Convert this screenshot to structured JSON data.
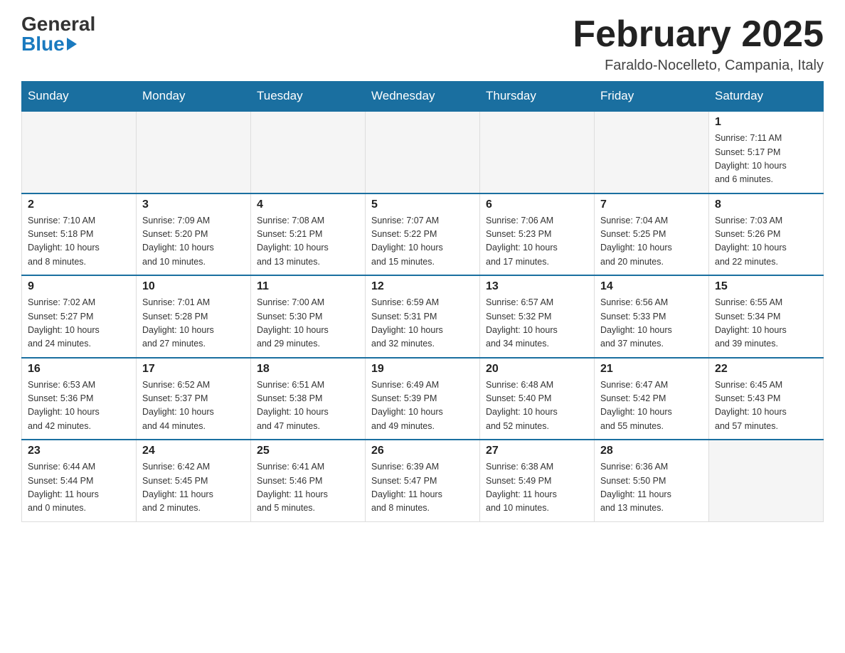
{
  "logo": {
    "line1": "General",
    "line2": "Blue"
  },
  "header": {
    "title": "February 2025",
    "subtitle": "Faraldo-Nocelleto, Campania, Italy"
  },
  "weekdays": [
    "Sunday",
    "Monday",
    "Tuesday",
    "Wednesday",
    "Thursday",
    "Friday",
    "Saturday"
  ],
  "weeks": [
    [
      {
        "day": "",
        "info": ""
      },
      {
        "day": "",
        "info": ""
      },
      {
        "day": "",
        "info": ""
      },
      {
        "day": "",
        "info": ""
      },
      {
        "day": "",
        "info": ""
      },
      {
        "day": "",
        "info": ""
      },
      {
        "day": "1",
        "info": "Sunrise: 7:11 AM\nSunset: 5:17 PM\nDaylight: 10 hours\nand 6 minutes."
      }
    ],
    [
      {
        "day": "2",
        "info": "Sunrise: 7:10 AM\nSunset: 5:18 PM\nDaylight: 10 hours\nand 8 minutes."
      },
      {
        "day": "3",
        "info": "Sunrise: 7:09 AM\nSunset: 5:20 PM\nDaylight: 10 hours\nand 10 minutes."
      },
      {
        "day": "4",
        "info": "Sunrise: 7:08 AM\nSunset: 5:21 PM\nDaylight: 10 hours\nand 13 minutes."
      },
      {
        "day": "5",
        "info": "Sunrise: 7:07 AM\nSunset: 5:22 PM\nDaylight: 10 hours\nand 15 minutes."
      },
      {
        "day": "6",
        "info": "Sunrise: 7:06 AM\nSunset: 5:23 PM\nDaylight: 10 hours\nand 17 minutes."
      },
      {
        "day": "7",
        "info": "Sunrise: 7:04 AM\nSunset: 5:25 PM\nDaylight: 10 hours\nand 20 minutes."
      },
      {
        "day": "8",
        "info": "Sunrise: 7:03 AM\nSunset: 5:26 PM\nDaylight: 10 hours\nand 22 minutes."
      }
    ],
    [
      {
        "day": "9",
        "info": "Sunrise: 7:02 AM\nSunset: 5:27 PM\nDaylight: 10 hours\nand 24 minutes."
      },
      {
        "day": "10",
        "info": "Sunrise: 7:01 AM\nSunset: 5:28 PM\nDaylight: 10 hours\nand 27 minutes."
      },
      {
        "day": "11",
        "info": "Sunrise: 7:00 AM\nSunset: 5:30 PM\nDaylight: 10 hours\nand 29 minutes."
      },
      {
        "day": "12",
        "info": "Sunrise: 6:59 AM\nSunset: 5:31 PM\nDaylight: 10 hours\nand 32 minutes."
      },
      {
        "day": "13",
        "info": "Sunrise: 6:57 AM\nSunset: 5:32 PM\nDaylight: 10 hours\nand 34 minutes."
      },
      {
        "day": "14",
        "info": "Sunrise: 6:56 AM\nSunset: 5:33 PM\nDaylight: 10 hours\nand 37 minutes."
      },
      {
        "day": "15",
        "info": "Sunrise: 6:55 AM\nSunset: 5:34 PM\nDaylight: 10 hours\nand 39 minutes."
      }
    ],
    [
      {
        "day": "16",
        "info": "Sunrise: 6:53 AM\nSunset: 5:36 PM\nDaylight: 10 hours\nand 42 minutes."
      },
      {
        "day": "17",
        "info": "Sunrise: 6:52 AM\nSunset: 5:37 PM\nDaylight: 10 hours\nand 44 minutes."
      },
      {
        "day": "18",
        "info": "Sunrise: 6:51 AM\nSunset: 5:38 PM\nDaylight: 10 hours\nand 47 minutes."
      },
      {
        "day": "19",
        "info": "Sunrise: 6:49 AM\nSunset: 5:39 PM\nDaylight: 10 hours\nand 49 minutes."
      },
      {
        "day": "20",
        "info": "Sunrise: 6:48 AM\nSunset: 5:40 PM\nDaylight: 10 hours\nand 52 minutes."
      },
      {
        "day": "21",
        "info": "Sunrise: 6:47 AM\nSunset: 5:42 PM\nDaylight: 10 hours\nand 55 minutes."
      },
      {
        "day": "22",
        "info": "Sunrise: 6:45 AM\nSunset: 5:43 PM\nDaylight: 10 hours\nand 57 minutes."
      }
    ],
    [
      {
        "day": "23",
        "info": "Sunrise: 6:44 AM\nSunset: 5:44 PM\nDaylight: 11 hours\nand 0 minutes."
      },
      {
        "day": "24",
        "info": "Sunrise: 6:42 AM\nSunset: 5:45 PM\nDaylight: 11 hours\nand 2 minutes."
      },
      {
        "day": "25",
        "info": "Sunrise: 6:41 AM\nSunset: 5:46 PM\nDaylight: 11 hours\nand 5 minutes."
      },
      {
        "day": "26",
        "info": "Sunrise: 6:39 AM\nSunset: 5:47 PM\nDaylight: 11 hours\nand 8 minutes."
      },
      {
        "day": "27",
        "info": "Sunrise: 6:38 AM\nSunset: 5:49 PM\nDaylight: 11 hours\nand 10 minutes."
      },
      {
        "day": "28",
        "info": "Sunrise: 6:36 AM\nSunset: 5:50 PM\nDaylight: 11 hours\nand 13 minutes."
      },
      {
        "day": "",
        "info": ""
      }
    ]
  ]
}
